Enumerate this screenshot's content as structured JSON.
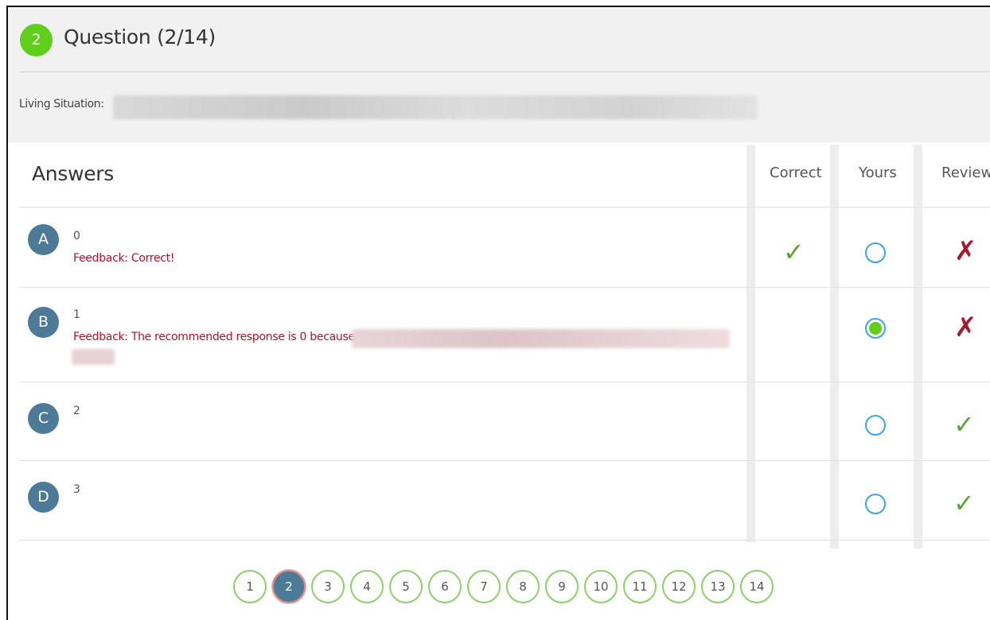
{
  "question": {
    "number": "2",
    "title": "Question (2/14)",
    "living_situation_label": "Living Situation:"
  },
  "answers_header": {
    "title": "Answers",
    "col_correct": "Correct",
    "col_yours": "Yours",
    "col_review": "Review"
  },
  "answers": [
    {
      "letter": "A",
      "value": "0",
      "feedback_label": "Feedback:",
      "feedback_text": "Correct!",
      "correct": true,
      "selected": false,
      "review": "incorrect"
    },
    {
      "letter": "B",
      "value": "1",
      "feedback_label": "Feedback:",
      "feedback_text": "The recommended response is 0 because",
      "correct": false,
      "selected": true,
      "review": "incorrect"
    },
    {
      "letter": "C",
      "value": "2",
      "correct": false,
      "selected": false,
      "review": "correct"
    },
    {
      "letter": "D",
      "value": "3",
      "correct": false,
      "selected": false,
      "review": "correct"
    }
  ],
  "pager": {
    "pages": [
      "1",
      "2",
      "3",
      "4",
      "5",
      "6",
      "7",
      "8",
      "9",
      "10",
      "11",
      "12",
      "13",
      "14"
    ],
    "current": "2"
  },
  "colors": {
    "badge_green": "#5fcf1c",
    "letter_blue": "#4c7a97",
    "feedback_red": "#b2122c",
    "check_green": "#5aa534",
    "x_red": "#a8192c",
    "radio_blue": "#3aa6e2"
  }
}
